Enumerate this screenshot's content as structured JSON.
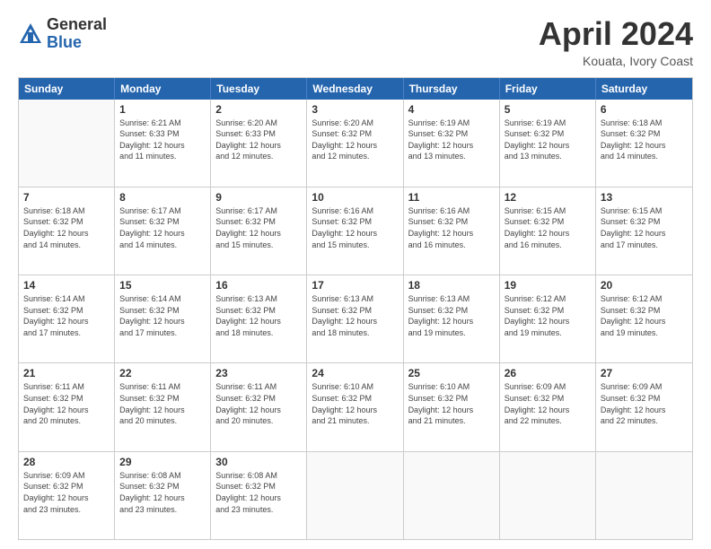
{
  "logo": {
    "general": "General",
    "blue": "Blue"
  },
  "title": {
    "month": "April 2024",
    "location": "Kouata, Ivory Coast"
  },
  "calendar": {
    "headers": [
      "Sunday",
      "Monday",
      "Tuesday",
      "Wednesday",
      "Thursday",
      "Friday",
      "Saturday"
    ],
    "rows": [
      [
        {
          "day": "",
          "info": ""
        },
        {
          "day": "1",
          "info": "Sunrise: 6:21 AM\nSunset: 6:33 PM\nDaylight: 12 hours\nand 11 minutes."
        },
        {
          "day": "2",
          "info": "Sunrise: 6:20 AM\nSunset: 6:33 PM\nDaylight: 12 hours\nand 12 minutes."
        },
        {
          "day": "3",
          "info": "Sunrise: 6:20 AM\nSunset: 6:32 PM\nDaylight: 12 hours\nand 12 minutes."
        },
        {
          "day": "4",
          "info": "Sunrise: 6:19 AM\nSunset: 6:32 PM\nDaylight: 12 hours\nand 13 minutes."
        },
        {
          "day": "5",
          "info": "Sunrise: 6:19 AM\nSunset: 6:32 PM\nDaylight: 12 hours\nand 13 minutes."
        },
        {
          "day": "6",
          "info": "Sunrise: 6:18 AM\nSunset: 6:32 PM\nDaylight: 12 hours\nand 14 minutes."
        }
      ],
      [
        {
          "day": "7",
          "info": "Sunrise: 6:18 AM\nSunset: 6:32 PM\nDaylight: 12 hours\nand 14 minutes."
        },
        {
          "day": "8",
          "info": "Sunrise: 6:17 AM\nSunset: 6:32 PM\nDaylight: 12 hours\nand 14 minutes."
        },
        {
          "day": "9",
          "info": "Sunrise: 6:17 AM\nSunset: 6:32 PM\nDaylight: 12 hours\nand 15 minutes."
        },
        {
          "day": "10",
          "info": "Sunrise: 6:16 AM\nSunset: 6:32 PM\nDaylight: 12 hours\nand 15 minutes."
        },
        {
          "day": "11",
          "info": "Sunrise: 6:16 AM\nSunset: 6:32 PM\nDaylight: 12 hours\nand 16 minutes."
        },
        {
          "day": "12",
          "info": "Sunrise: 6:15 AM\nSunset: 6:32 PM\nDaylight: 12 hours\nand 16 minutes."
        },
        {
          "day": "13",
          "info": "Sunrise: 6:15 AM\nSunset: 6:32 PM\nDaylight: 12 hours\nand 17 minutes."
        }
      ],
      [
        {
          "day": "14",
          "info": "Sunrise: 6:14 AM\nSunset: 6:32 PM\nDaylight: 12 hours\nand 17 minutes."
        },
        {
          "day": "15",
          "info": "Sunrise: 6:14 AM\nSunset: 6:32 PM\nDaylight: 12 hours\nand 17 minutes."
        },
        {
          "day": "16",
          "info": "Sunrise: 6:13 AM\nSunset: 6:32 PM\nDaylight: 12 hours\nand 18 minutes."
        },
        {
          "day": "17",
          "info": "Sunrise: 6:13 AM\nSunset: 6:32 PM\nDaylight: 12 hours\nand 18 minutes."
        },
        {
          "day": "18",
          "info": "Sunrise: 6:13 AM\nSunset: 6:32 PM\nDaylight: 12 hours\nand 19 minutes."
        },
        {
          "day": "19",
          "info": "Sunrise: 6:12 AM\nSunset: 6:32 PM\nDaylight: 12 hours\nand 19 minutes."
        },
        {
          "day": "20",
          "info": "Sunrise: 6:12 AM\nSunset: 6:32 PM\nDaylight: 12 hours\nand 19 minutes."
        }
      ],
      [
        {
          "day": "21",
          "info": "Sunrise: 6:11 AM\nSunset: 6:32 PM\nDaylight: 12 hours\nand 20 minutes."
        },
        {
          "day": "22",
          "info": "Sunrise: 6:11 AM\nSunset: 6:32 PM\nDaylight: 12 hours\nand 20 minutes."
        },
        {
          "day": "23",
          "info": "Sunrise: 6:11 AM\nSunset: 6:32 PM\nDaylight: 12 hours\nand 20 minutes."
        },
        {
          "day": "24",
          "info": "Sunrise: 6:10 AM\nSunset: 6:32 PM\nDaylight: 12 hours\nand 21 minutes."
        },
        {
          "day": "25",
          "info": "Sunrise: 6:10 AM\nSunset: 6:32 PM\nDaylight: 12 hours\nand 21 minutes."
        },
        {
          "day": "26",
          "info": "Sunrise: 6:09 AM\nSunset: 6:32 PM\nDaylight: 12 hours\nand 22 minutes."
        },
        {
          "day": "27",
          "info": "Sunrise: 6:09 AM\nSunset: 6:32 PM\nDaylight: 12 hours\nand 22 minutes."
        }
      ],
      [
        {
          "day": "28",
          "info": "Sunrise: 6:09 AM\nSunset: 6:32 PM\nDaylight: 12 hours\nand 23 minutes."
        },
        {
          "day": "29",
          "info": "Sunrise: 6:08 AM\nSunset: 6:32 PM\nDaylight: 12 hours\nand 23 minutes."
        },
        {
          "day": "30",
          "info": "Sunrise: 6:08 AM\nSunset: 6:32 PM\nDaylight: 12 hours\nand 23 minutes."
        },
        {
          "day": "",
          "info": ""
        },
        {
          "day": "",
          "info": ""
        },
        {
          "day": "",
          "info": ""
        },
        {
          "day": "",
          "info": ""
        }
      ]
    ]
  }
}
